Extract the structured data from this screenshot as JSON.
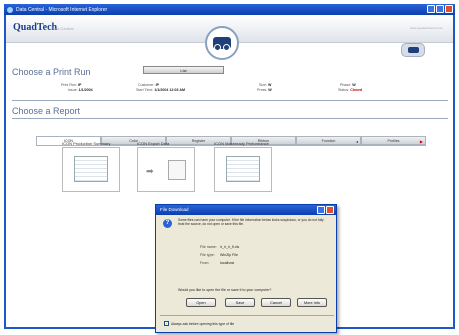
{
  "window": {
    "title": "Data Central - Microsoft Internet Explorer"
  },
  "header": {
    "logo": "QuadTech",
    "logo_sub": "Data Central",
    "top_right": "www.quadtechworld.com"
  },
  "print_run": {
    "heading": "Choose a Print Run",
    "list_button": "List",
    "fields": [
      {
        "label": "Print Run:",
        "value": "IP"
      },
      {
        "label": "Issue:",
        "value": "1/1/2004"
      },
      {
        "label": "Customer:",
        "value": "IP"
      },
      {
        "label": "Start Time:",
        "value": "1/1/2004 12:03 AM"
      },
      {
        "label": "Size:",
        "value": "W"
      },
      {
        "label": "Press:",
        "value": "W"
      },
      {
        "label": "Phase:",
        "value": "W"
      },
      {
        "label": "Status:",
        "value": "Closed"
      }
    ]
  },
  "report": {
    "heading": "Choose a Report",
    "tabs": [
      "ICON",
      "Color",
      "Register",
      "Ribbon",
      "Function",
      "Profiles"
    ],
    "items": [
      {
        "label": "ICON Production Summary"
      },
      {
        "label": "ICON Export Data"
      },
      {
        "label": "ICON Makeready Performance"
      }
    ]
  },
  "dialog": {
    "title": "File Download",
    "warning": "Some files can harm your computer. If the file information below looks suspicious, or you do not fully trust the source, do not open or save this file.",
    "file_name_label": "File name:",
    "file_name": "ir_ir_ir_fl.xls",
    "file_type_label": "File type:",
    "file_type": "WinZip File",
    "from_label": "From:",
    "from": "localhost",
    "question": "Would you like to open the file or save it to your computer?",
    "buttons": {
      "open": "Open",
      "save": "Save",
      "cancel": "Cancel",
      "more": "More Info"
    },
    "checkbox": "Always ask before opening this type of file"
  }
}
